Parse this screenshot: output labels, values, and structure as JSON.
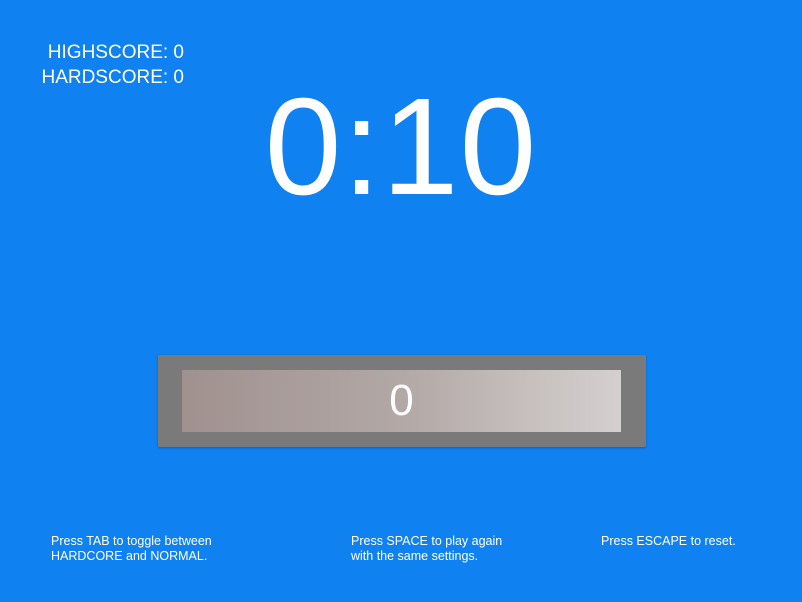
{
  "scores": {
    "highscore_label": "HIGHSCORE: 0",
    "hardscore_label": "HARDSCORE: 0"
  },
  "timer": {
    "value": "0:10"
  },
  "counter": {
    "value": "0"
  },
  "hints": {
    "tab_line1": "Press TAB to toggle between",
    "tab_line2": "HARDCORE and NORMAL.",
    "space_line1": "Press SPACE to play again",
    "space_line2": "with the same settings.",
    "escape_line1": "Press ESCAPE to reset."
  },
  "colors": {
    "background": "#0f81f0",
    "panel": "#7a7a7a",
    "text": "#ffffff"
  }
}
